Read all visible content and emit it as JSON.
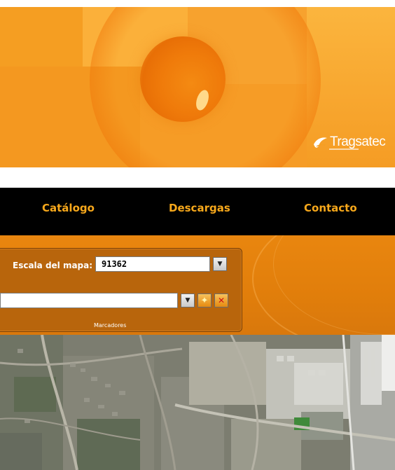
{
  "banner": {
    "logo_text": "Tragsatec"
  },
  "nav": {
    "items": [
      {
        "label": "Catálogo"
      },
      {
        "label": "Descargas"
      },
      {
        "label": "Contacto"
      }
    ]
  },
  "toolbar": {
    "scale_label": "Escala del mapa:",
    "scale_value": "91362",
    "bookmark_value": "",
    "bookmarks_caption": "Marcadores"
  },
  "colors": {
    "nav_text": "#f7a81b",
    "nav_background": "#000000",
    "banner_orange": "#f7a630"
  },
  "icons": {
    "dropdown": "triangle-down-icon",
    "add": "star-add-icon",
    "delete": "x-delete-icon"
  }
}
